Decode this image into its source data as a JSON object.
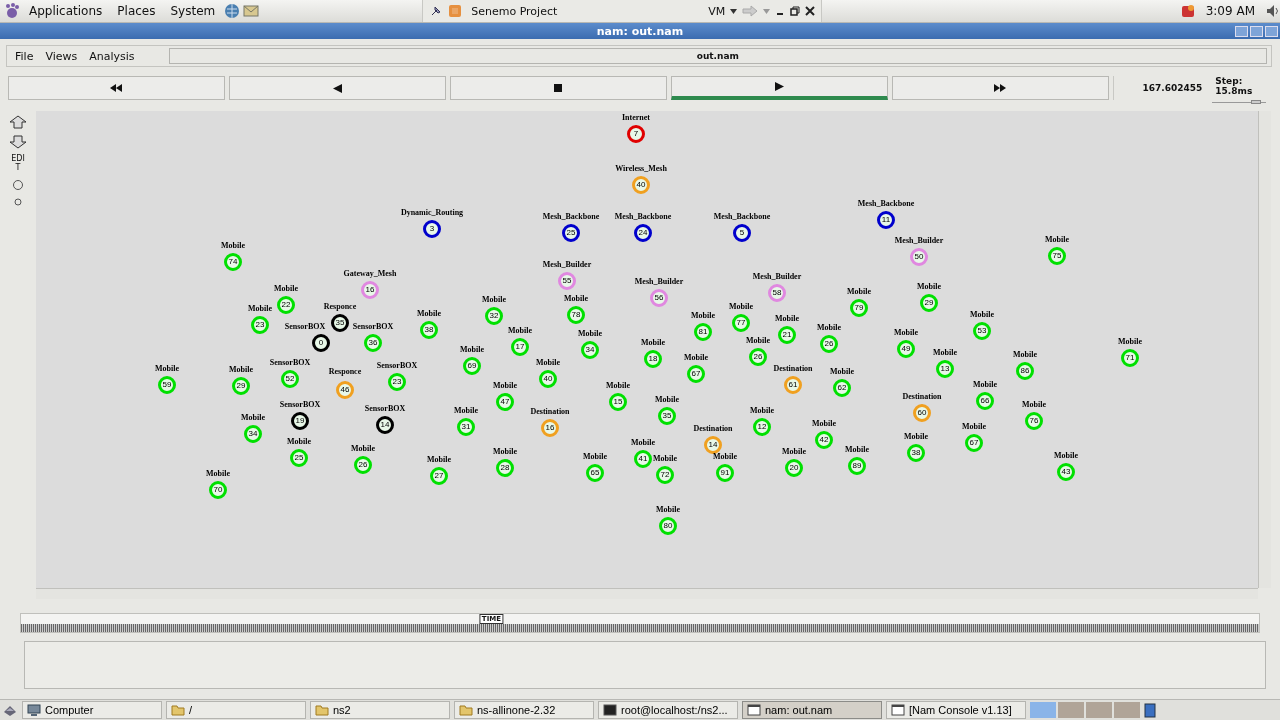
{
  "top_panel": {
    "menus": [
      "Applications",
      "Places",
      "System"
    ],
    "window_button": {
      "title": "Senemo Project",
      "menu": "VM"
    },
    "clock": "3:09 AM"
  },
  "window": {
    "title": "nam: out.nam"
  },
  "menu": [
    "File",
    "Views",
    "Analysis"
  ],
  "file_field": "out.nam",
  "playback": {
    "buttons": [
      {
        "kind": "rewind",
        "selected": false
      },
      {
        "kind": "back",
        "selected": false
      },
      {
        "kind": "stop",
        "selected": false
      },
      {
        "kind": "play",
        "selected": true
      },
      {
        "kind": "forward",
        "selected": false
      }
    ],
    "time": "167.602455",
    "step": {
      "label": "Step: 15.8ms",
      "level": 0.8
    }
  },
  "tools": {
    "edit_label": "EDIT"
  },
  "nodes": [
    {
      "label": "Internet",
      "number": "7",
      "color": "#e00000"
    },
    {
      "label": "Wireless_Mesh",
      "number": "40",
      "color": "#f0a020"
    },
    {
      "label": "Dynamic_Routing",
      "number": "3",
      "color": "#0000cc"
    },
    {
      "label": "Mesh_Backbone",
      "number": "25",
      "color": "#0000cc"
    },
    {
      "label": "Mesh_Backbone",
      "number": "24",
      "color": "#0000cc"
    },
    {
      "label": "Mesh_Backbone",
      "number": "5",
      "color": "#0000cc"
    },
    {
      "label": "Mesh_Backbone",
      "number": "11",
      "color": "#0000cc"
    },
    {
      "label": "Mobile",
      "number": "74",
      "color": "#00e000"
    },
    {
      "label": "Mesh_Builder",
      "number": "50",
      "color": "#e088e0"
    },
    {
      "label": "Mobile",
      "number": "75",
      "color": "#00e000"
    },
    {
      "label": "Gateway_Mesh",
      "number": "16",
      "color": "#e088e0"
    },
    {
      "label": "Mesh_Builder",
      "number": "55",
      "color": "#e088e0"
    },
    {
      "label": "Mesh_Builder",
      "number": "56",
      "color": "#e088e0"
    },
    {
      "label": "Mesh_Builder",
      "number": "58",
      "color": "#e088e0"
    },
    {
      "label": "Mobile",
      "number": "22",
      "color": "#00e000"
    },
    {
      "label": "Mobile",
      "number": "79",
      "color": "#00e000"
    },
    {
      "label": "Mobile",
      "number": "29",
      "color": "#00e000"
    },
    {
      "label": "Mobile",
      "number": "23",
      "color": "#00e000"
    },
    {
      "label": "Responce",
      "number": "35",
      "color": "#000000"
    },
    {
      "label": "Mobile",
      "number": "38",
      "color": "#00e000"
    },
    {
      "label": "Mobile",
      "number": "32",
      "color": "#00e000"
    },
    {
      "label": "Mobile",
      "number": "78",
      "color": "#00e000"
    },
    {
      "label": "Mobile",
      "number": "81",
      "color": "#00e000"
    },
    {
      "label": "Mobile",
      "number": "77",
      "color": "#00e000"
    },
    {
      "label": "Mobile",
      "number": "21",
      "color": "#00e000"
    },
    {
      "label": "Mobile",
      "number": "53",
      "color": "#00e000"
    },
    {
      "label": "SensorBOX",
      "number": "0",
      "color": "#000000"
    },
    {
      "label": "SensorBOX",
      "number": "36",
      "color": "#00e000"
    },
    {
      "label": "Mobile",
      "number": "69",
      "color": "#00e000"
    },
    {
      "label": "Mobile",
      "number": "17",
      "color": "#00e000"
    },
    {
      "label": "Mobile",
      "number": "34",
      "color": "#00e000"
    },
    {
      "label": "Mobile",
      "number": "18",
      "color": "#00e000"
    },
    {
      "label": "Mobile",
      "number": "67",
      "color": "#00e000"
    },
    {
      "label": "Mobile",
      "number": "26",
      "color": "#00e000"
    },
    {
      "label": "Mobile",
      "number": "26",
      "color": "#00e000"
    },
    {
      "label": "Mobile",
      "number": "49",
      "color": "#00e000"
    },
    {
      "label": "Mobile",
      "number": "13",
      "color": "#00e000"
    },
    {
      "label": "Mobile",
      "number": "86",
      "color": "#00e000"
    },
    {
      "label": "Mobile",
      "number": "71",
      "color": "#00e000"
    },
    {
      "label": "Mobile",
      "number": "59",
      "color": "#00e000"
    },
    {
      "label": "Mobile",
      "number": "29",
      "color": "#00e000"
    },
    {
      "label": "SensorBOX",
      "number": "52",
      "color": "#00e000"
    },
    {
      "label": "Responce",
      "number": "46",
      "color": "#f0a020"
    },
    {
      "label": "SensorBOX",
      "number": "23",
      "color": "#00e000"
    },
    {
      "label": "Mobile",
      "number": "40",
      "color": "#00e000"
    },
    {
      "label": "Destination",
      "number": "61",
      "color": "#f0a020"
    },
    {
      "label": "Mobile",
      "number": "62",
      "color": "#00e000"
    },
    {
      "label": "Mobile",
      "number": "47",
      "color": "#00e000"
    },
    {
      "label": "Mobile",
      "number": "15",
      "color": "#00e000"
    },
    {
      "label": "Mobile",
      "number": "66",
      "color": "#00e000"
    },
    {
      "label": "Mobile",
      "number": "34",
      "color": "#00e000"
    },
    {
      "label": "SensorBOX",
      "number": "19",
      "color": "#000000"
    },
    {
      "label": "SensorBOX",
      "number": "14",
      "color": "#000000"
    },
    {
      "label": "Mobile",
      "number": "31",
      "color": "#00e000"
    },
    {
      "label": "Destination",
      "number": "16",
      "color": "#f0a020"
    },
    {
      "label": "Mobile",
      "number": "35",
      "color": "#00e000"
    },
    {
      "label": "Destination",
      "number": "14",
      "color": "#f0a020"
    },
    {
      "label": "Mobile",
      "number": "12",
      "color": "#00e000"
    },
    {
      "label": "Mobile",
      "number": "42",
      "color": "#00e000"
    },
    {
      "label": "Destination",
      "number": "60",
      "color": "#f0a020"
    },
    {
      "label": "Mobile",
      "number": "67",
      "color": "#00e000"
    },
    {
      "label": "Mobile",
      "number": "76",
      "color": "#00e000"
    },
    {
      "label": "Mobile",
      "number": "25",
      "color": "#00e000"
    },
    {
      "label": "Mobile",
      "number": "26",
      "color": "#00e000"
    },
    {
      "label": "Mobile",
      "number": "27",
      "color": "#00e000"
    },
    {
      "label": "Mobile",
      "number": "28",
      "color": "#00e000"
    },
    {
      "label": "Mobile",
      "number": "65",
      "color": "#00e000"
    },
    {
      "label": "Mobile",
      "number": "41",
      "color": "#00e000"
    },
    {
      "label": "Mobile",
      "number": "72",
      "color": "#00e000"
    },
    {
      "label": "Mobile",
      "number": "91",
      "color": "#00e000"
    },
    {
      "label": "Mobile",
      "number": "20",
      "color": "#00e000"
    },
    {
      "label": "Mobile",
      "number": "89",
      "color": "#00e000"
    },
    {
      "label": "Mobile",
      "number": "38",
      "color": "#00e000"
    },
    {
      "label": "Mobile",
      "number": "43",
      "color": "#00e000"
    },
    {
      "label": "Mobile",
      "number": "70",
      "color": "#00e000"
    },
    {
      "label": "Mobile",
      "number": "80",
      "color": "#00e000"
    }
  ],
  "timeline": {
    "marker": "TIME",
    "level": 0.38
  },
  "taskbar": {
    "items": [
      {
        "kind": "computer",
        "label": "Computer",
        "selected": false
      },
      {
        "kind": "folder",
        "label": "/",
        "selected": false
      },
      {
        "kind": "folder",
        "label": "ns2",
        "selected": false
      },
      {
        "kind": "folder",
        "label": "ns-allinone-2.32",
        "selected": false
      },
      {
        "kind": "terminal",
        "label": "root@localhost:/ns2...",
        "selected": false
      },
      {
        "kind": "window",
        "label": "nam: out.nam",
        "selected": true
      },
      {
        "kind": "window",
        "label": "[Nam Console v1.13]",
        "selected": false
      }
    ]
  }
}
